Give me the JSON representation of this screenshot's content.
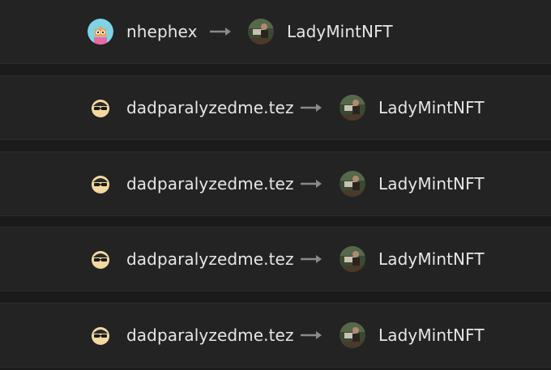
{
  "transfers": [
    {
      "from": "nhephex",
      "from_avatar": "cat-avatar-icon",
      "to": "LadyMintNFT",
      "to_avatar": "photo-avatar-icon"
    },
    {
      "from": "dadparalyzedme.tez",
      "from_avatar": "sunglasses-face-avatar-icon",
      "to": "LadyMintNFT",
      "to_avatar": "photo-avatar-icon"
    },
    {
      "from": "dadparalyzedme.tez",
      "from_avatar": "sunglasses-face-avatar-icon",
      "to": "LadyMintNFT",
      "to_avatar": "photo-avatar-icon"
    },
    {
      "from": "dadparalyzedme.tez",
      "from_avatar": "sunglasses-face-avatar-icon",
      "to": "LadyMintNFT",
      "to_avatar": "photo-avatar-icon"
    },
    {
      "from": "dadparalyzedme.tez",
      "from_avatar": "sunglasses-face-avatar-icon",
      "to": "LadyMintNFT",
      "to_avatar": "photo-avatar-icon"
    }
  ],
  "colors": {
    "background": "#1b1b1b",
    "row": "#232323",
    "text": "#e6e6e6",
    "arrow": "#8a8a8a"
  }
}
